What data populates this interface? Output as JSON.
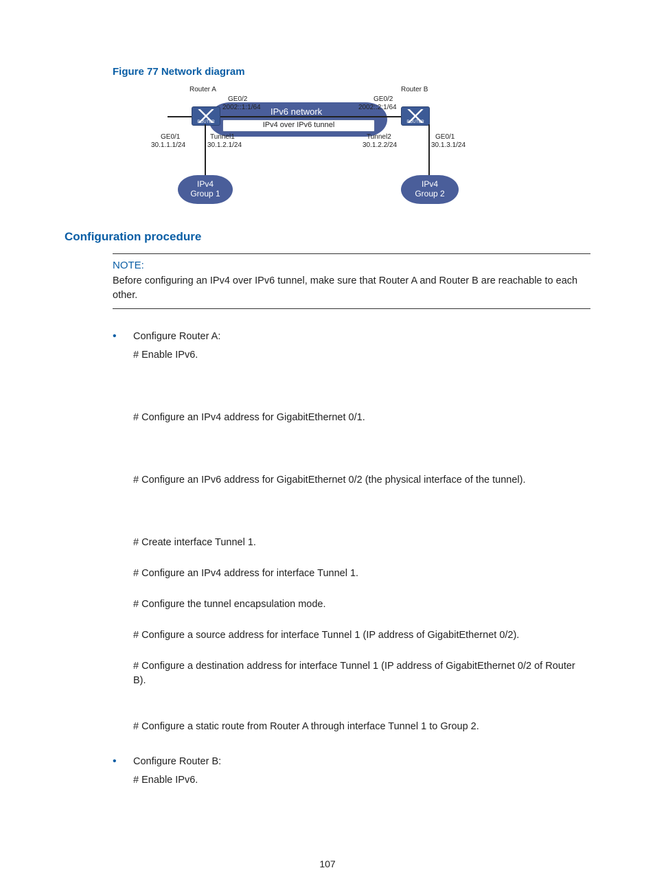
{
  "figure": {
    "caption": "Figure 77 Network diagram",
    "routerA": "Router A",
    "routerB": "Router B",
    "ge02": "GE0/2",
    "a_ge02_ip": "2002::1:1/64",
    "b_ge02_ip": "2002::2:1/64",
    "ge01": "GE0/1",
    "a_ge01_ip": "30.1.1.1/24",
    "b_ge01_ip": "30.1.3.1/24",
    "tunnel1": "Tunnel1",
    "tunnel1_ip": "30.1.2.1/24",
    "tunnel2": "Tunnel2",
    "tunnel2_ip": "30.1.2.2/24",
    "ipv6_network": "IPv6 network",
    "tunnel_box": "IPv4 over IPv6 tunnel",
    "group1_l1": "IPv4",
    "group1_l2": "Group 1",
    "group2_l1": "IPv4",
    "group2_l2": "Group 2",
    "router_tag": "ROUTER"
  },
  "section": {
    "heading": "Configuration procedure",
    "noteLabel": "NOTE:",
    "noteBody": "Before configuring an IPv4 over IPv6 tunnel, make sure that Router A and Router B are reachable to each other."
  },
  "listA": {
    "title": "Configure Router A:",
    "steps": {
      "s1": "# Enable IPv6.",
      "s2": "# Configure an IPv4 address for GigabitEthernet 0/1.",
      "s3": "# Configure an IPv6 address for GigabitEthernet 0/2 (the physical interface of the tunnel).",
      "s4": "# Create interface Tunnel 1.",
      "s5": "# Configure an IPv4 address for interface Tunnel 1.",
      "s6": "# Configure the tunnel encapsulation mode.",
      "s7": "# Configure a source address for interface Tunnel 1 (IP address of GigabitEthernet 0/2).",
      "s8": "# Configure a destination address for interface Tunnel 1 (IP address of GigabitEthernet 0/2 of Router B).",
      "s9": "# Configure a static route from Router A through interface Tunnel 1 to Group 2."
    }
  },
  "listB": {
    "title": "Configure Router B:",
    "steps": {
      "s1": "# Enable IPv6."
    }
  },
  "pageNumber": "107"
}
